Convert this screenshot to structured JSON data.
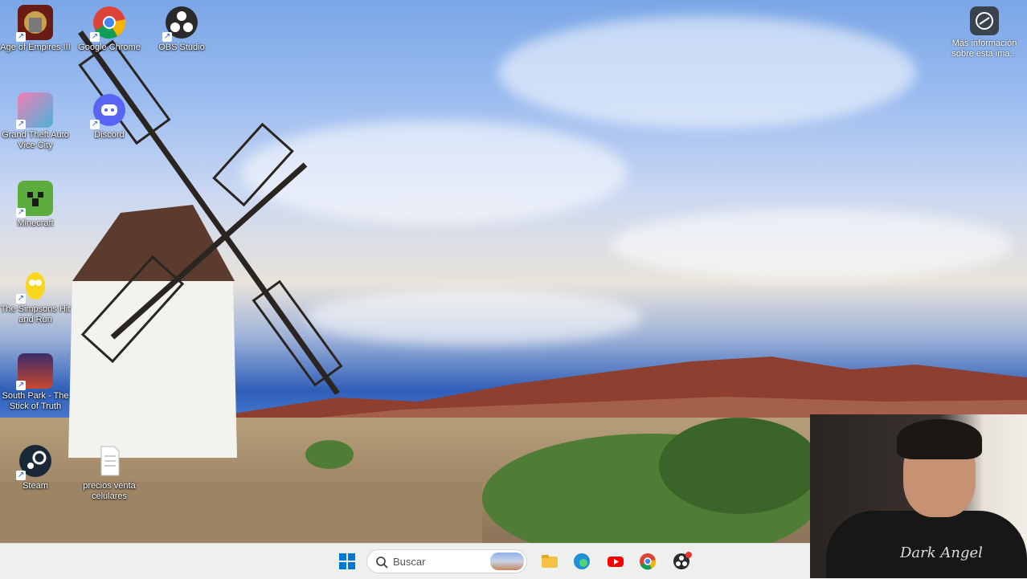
{
  "desktop_icons": [
    {
      "label": "Age of Empires III",
      "icon": "age-of-empires-icon"
    },
    {
      "label": "Google Chrome",
      "icon": "chrome-icon"
    },
    {
      "label": "OBS Studio",
      "icon": "obs-icon"
    },
    {
      "label": "Grand Theft Auto Vice City",
      "icon": "gta-vice-city-icon"
    },
    {
      "label": "Discord",
      "icon": "discord-icon"
    },
    {
      "label": "Minecraft",
      "icon": "minecraft-icon"
    },
    {
      "label": "The Simpsons Hit and Run",
      "icon": "simpsons-icon"
    },
    {
      "label": "South Park - The Stick of Truth",
      "icon": "south-park-icon"
    },
    {
      "label": "Steam",
      "icon": "steam-icon"
    },
    {
      "label": "precios venta celulares",
      "icon": "document-icon"
    }
  ],
  "info_button": {
    "label": "Más información sobre esta ima...",
    "icon": "camera-info-icon"
  },
  "taskbar": {
    "search_placeholder": "Buscar",
    "apps": [
      "windows-start-icon",
      "file-explorer-icon",
      "edge-icon",
      "youtube-icon",
      "chrome-icon",
      "obs-icon"
    ]
  },
  "webcam": {
    "shirt_text": "Dark Angel"
  },
  "colors": {
    "taskbar": "#eef0ee",
    "accent": "#0067c0"
  }
}
